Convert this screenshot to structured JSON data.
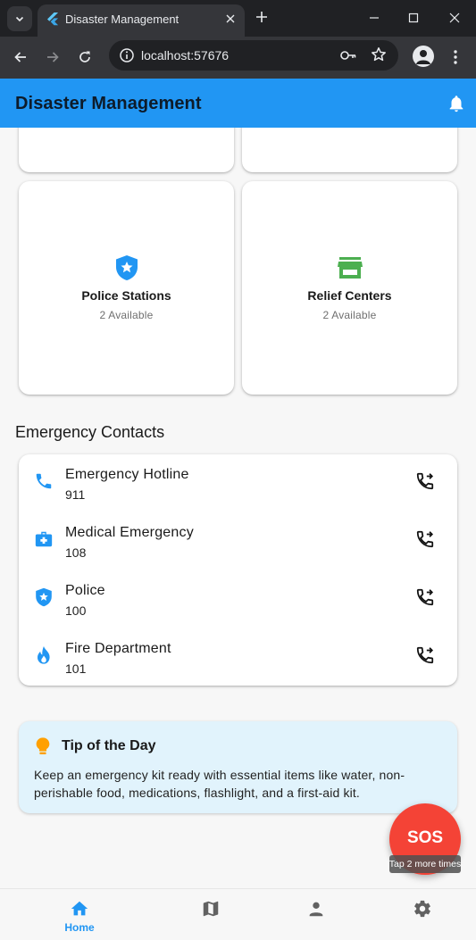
{
  "browser": {
    "tab_title": "Disaster Management",
    "url": "localhost:57676"
  },
  "app": {
    "title": "Disaster Management",
    "accent_color": "#2196f3",
    "facilities": [
      {
        "title": "Police Stations",
        "subtitle": "2 Available",
        "icon": "police-shield-icon",
        "color": "#2196f3"
      },
      {
        "title": "Relief Centers",
        "subtitle": "2 Available",
        "icon": "store-icon",
        "color": "#4caf50"
      }
    ],
    "contacts_heading": "Emergency Contacts",
    "contacts": [
      {
        "name": "Emergency Hotline",
        "number": "911",
        "icon": "phone-icon"
      },
      {
        "name": "Medical Emergency",
        "number": "108",
        "icon": "medical-kit-icon"
      },
      {
        "name": "Police",
        "number": "100",
        "icon": "police-shield-icon"
      },
      {
        "name": "Fire Department",
        "number": "101",
        "icon": "fire-icon"
      }
    ],
    "tip": {
      "title": "Tip of the Day",
      "text": "Keep an emergency kit ready with essential items like water, non-perishable food, medications, flashlight, and a first-aid kit."
    },
    "sos": {
      "label": "SOS",
      "hint": "Tap 2 more times",
      "color": "#f44336"
    },
    "bottom_nav": {
      "items": [
        {
          "label": "Home",
          "icon": "home-icon",
          "active": true
        },
        {
          "label": "",
          "icon": "map-icon",
          "active": false
        },
        {
          "label": "",
          "icon": "person-icon",
          "active": false
        },
        {
          "label": "",
          "icon": "settings-icon",
          "active": false
        }
      ]
    }
  }
}
